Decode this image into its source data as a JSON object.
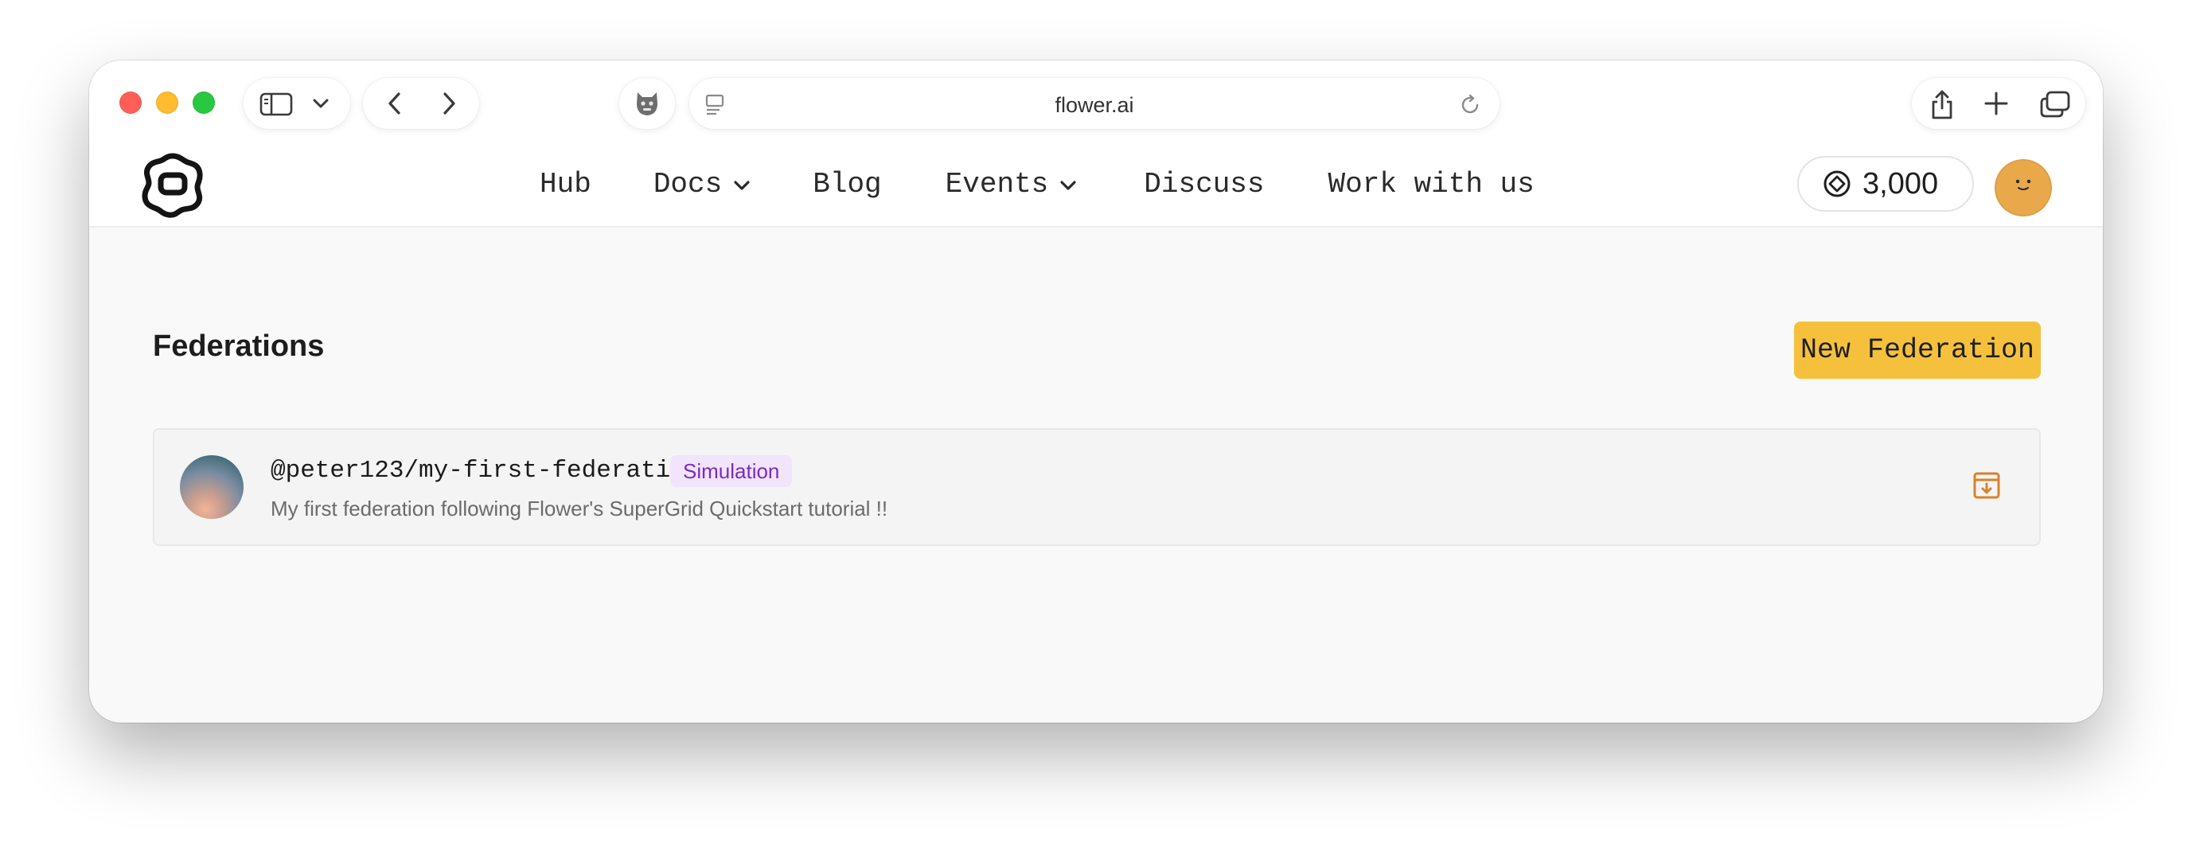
{
  "browser": {
    "url": "flower.ai"
  },
  "site": {
    "nav": [
      {
        "label": "Hub",
        "dropdown": false
      },
      {
        "label": "Docs",
        "dropdown": true
      },
      {
        "label": "Blog",
        "dropdown": false
      },
      {
        "label": "Events",
        "dropdown": true
      },
      {
        "label": "Discuss",
        "dropdown": false
      },
      {
        "label": "Work with us",
        "dropdown": false
      }
    ],
    "credits": "3,000",
    "colors": {
      "accent_button": "#f5c13d",
      "badge_text": "#7b2cbf",
      "badge_bg": "#f1e4fb",
      "avatar": "#e9a94a",
      "archive_icon": "#d9822b"
    }
  },
  "main": {
    "title": "Federations",
    "new_button": "New Federation",
    "federations": [
      {
        "name": "@peter123/my-first-federation",
        "badge": "Simulation",
        "description": "My first federation following Flower's SuperGrid Quickstart tutorial !!",
        "action_icon": "archive-icon"
      }
    ]
  },
  "icons": {
    "sidebar": "sidebar-icon",
    "back": "chevron-left-icon",
    "forward": "chevron-right-icon",
    "extension": "extension-icon",
    "reader": "reader-icon",
    "reload": "reload-icon",
    "share": "share-icon",
    "new_tab": "plus-icon",
    "tabs": "tabs-overview-icon",
    "logo": "flower-logo",
    "credit": "credit-icon"
  }
}
